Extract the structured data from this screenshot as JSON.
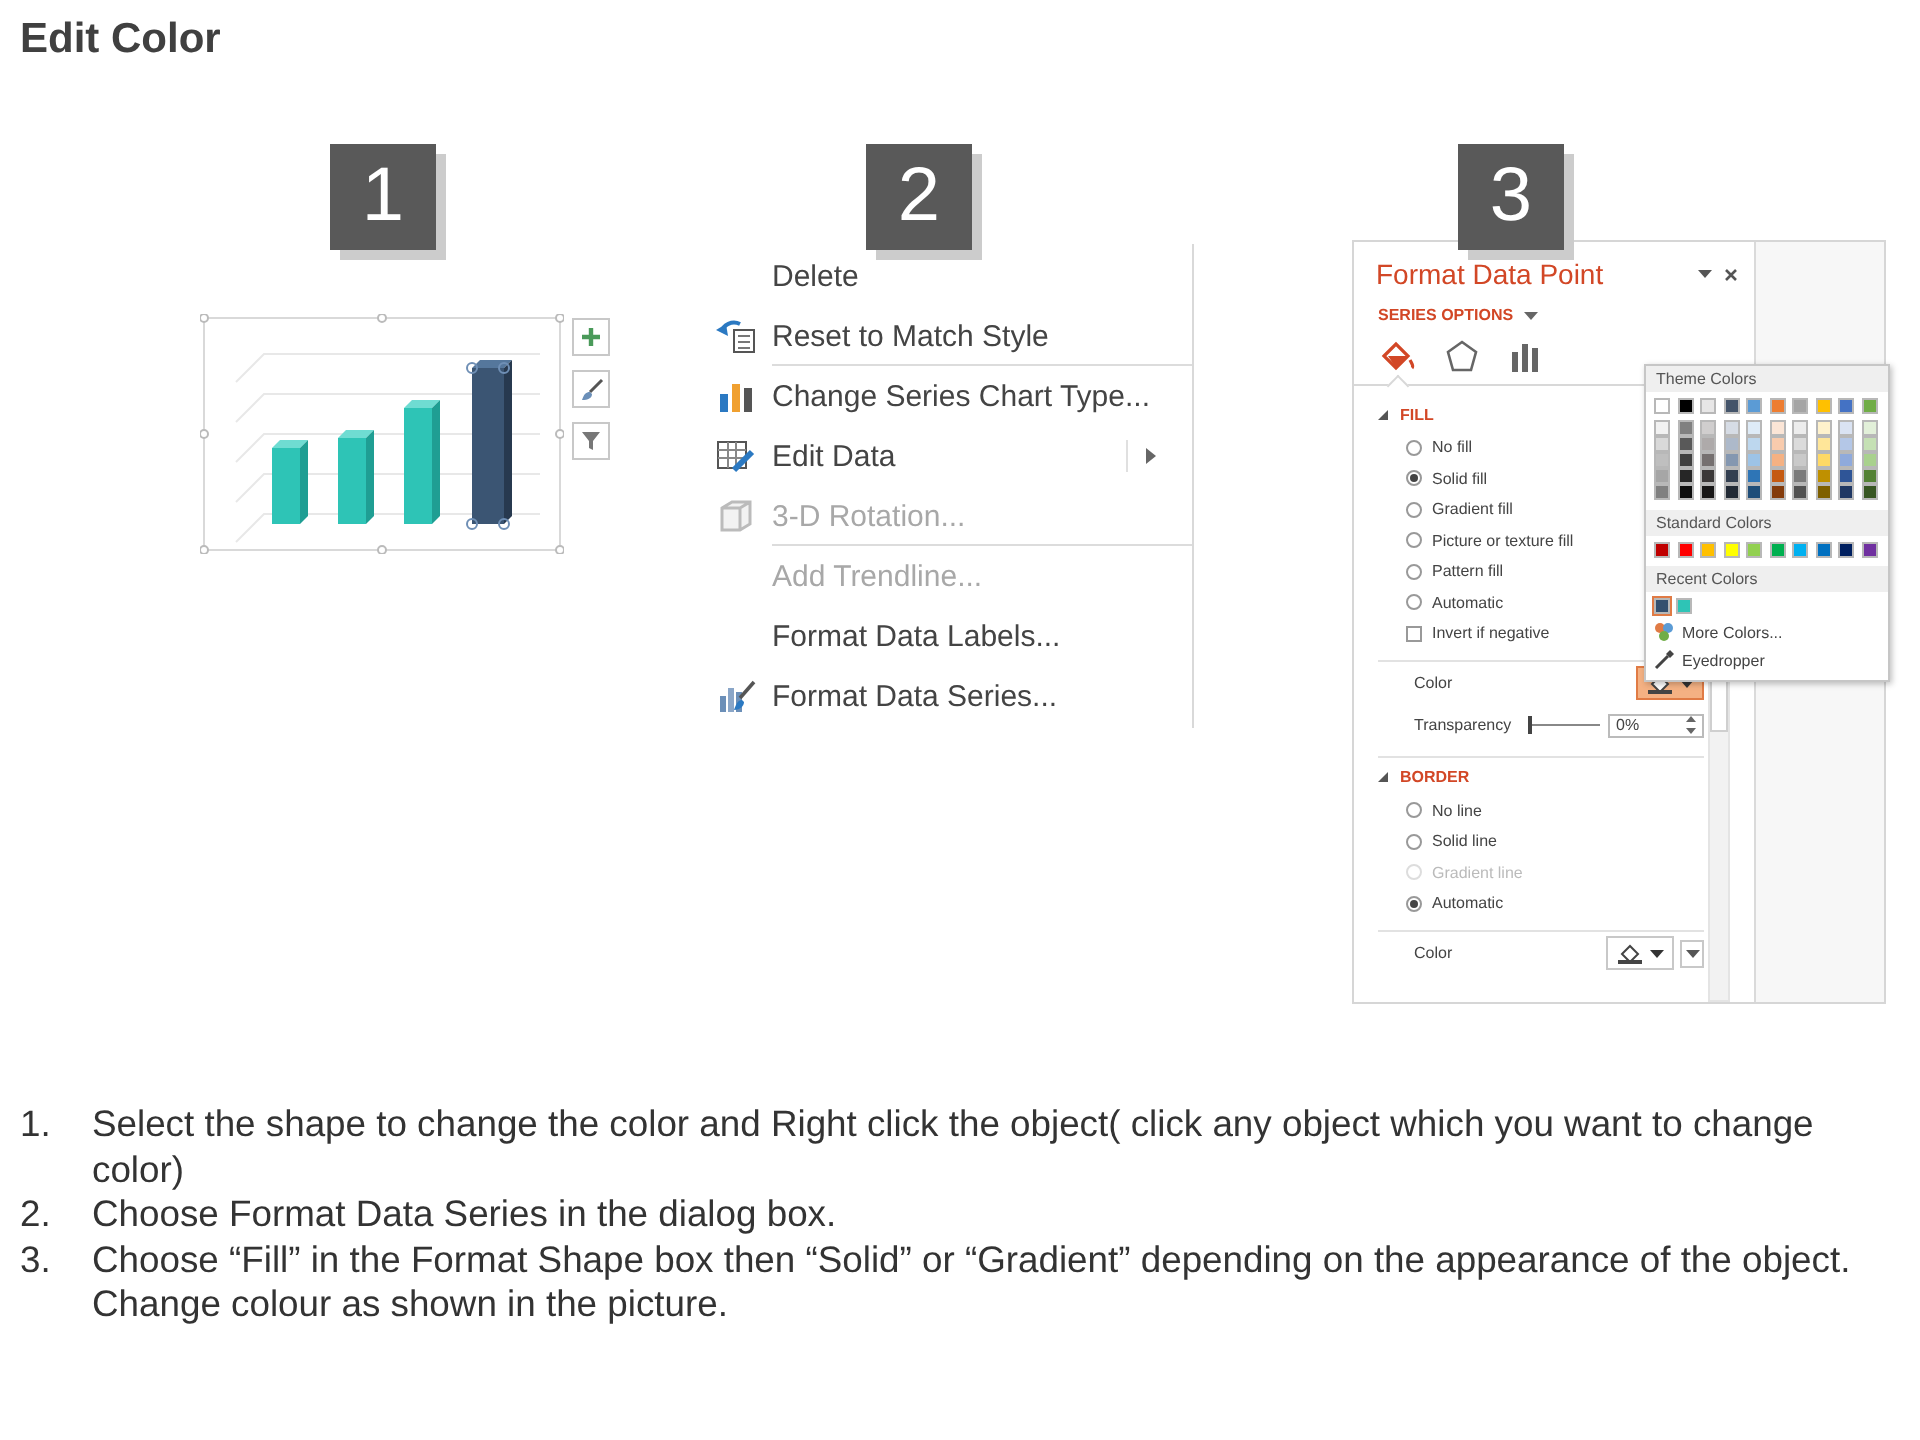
{
  "title": "Edit Color",
  "panels": [
    {
      "kind": "chart",
      "badge": "1",
      "bars": [
        {
          "selected": false
        },
        {
          "selected": false
        },
        {
          "selected": false
        },
        {
          "selected": true
        }
      ]
    },
    {
      "kind": "menu",
      "badge": "2",
      "items": [
        {
          "label": "Delete",
          "disabled": false,
          "separator_after": false,
          "submenu": false
        },
        {
          "label": "Reset to Match Style",
          "disabled": false,
          "separator_after": true,
          "submenu": false
        },
        {
          "label": "Change Series Chart Type...",
          "disabled": false,
          "separator_after": false,
          "submenu": false
        },
        {
          "label": "Edit Data",
          "disabled": false,
          "separator_after": false,
          "submenu": true
        },
        {
          "label": "3-D Rotation...",
          "disabled": true,
          "separator_after": true,
          "submenu": false
        },
        {
          "label": "Add Trendline...",
          "disabled": true,
          "separator_after": false,
          "submenu": false
        },
        {
          "label": "Format Data Labels...",
          "disabled": false,
          "separator_after": false,
          "submenu": false
        },
        {
          "label": "Format Data Series...",
          "disabled": false,
          "separator_after": false,
          "submenu": false
        }
      ]
    },
    {
      "kind": "pane",
      "badge": "3",
      "title": "Format Data Point",
      "section_menu": "SERIES OPTIONS",
      "tabs": [
        {
          "selected": true
        },
        {
          "selected": false
        },
        {
          "selected": false
        }
      ],
      "sections": [
        {
          "heading": "FILL",
          "expanded": true,
          "options": [
            {
              "label": "No fill",
              "selected": false,
              "disabled": false
            },
            {
              "label": "Solid fill",
              "selected": true,
              "disabled": false
            },
            {
              "label": "Gradient fill",
              "selected": false,
              "disabled": false
            },
            {
              "label": "Picture or texture fill",
              "selected": false,
              "disabled": false
            },
            {
              "label": "Pattern fill",
              "selected": false,
              "disabled": false
            },
            {
              "label": "Automatic",
              "selected": false,
              "disabled": false
            }
          ],
          "checkbox": {
            "label": "Invert if negative",
            "checked": false
          },
          "color": {
            "label": "Color",
            "active": true
          },
          "transparency": {
            "label": "Transparency",
            "level": 0,
            "value": "0%"
          }
        },
        {
          "heading": "BORDER",
          "expanded": true,
          "options": [
            {
              "label": "No line",
              "selected": false,
              "disabled": false
            },
            {
              "label": "Solid line",
              "selected": false,
              "disabled": false
            },
            {
              "label": "Gradient line",
              "selected": false,
              "disabled": true
            },
            {
              "label": "Automatic",
              "selected": true,
              "disabled": false
            }
          ],
          "color": {
            "label": "Color",
            "active": false
          }
        }
      ],
      "color_menu": {
        "theme_heading": "Theme Colors",
        "theme_colors": [
          {
            "color": "#ffffff",
            "shades": [
              {
                "color": "#f2f2f2"
              },
              {
                "color": "#d9d9d9"
              },
              {
                "color": "#bfbfbf"
              },
              {
                "color": "#a6a6a6"
              },
              {
                "color": "#808080"
              }
            ]
          },
          {
            "color": "#000000",
            "shades": [
              {
                "color": "#808080"
              },
              {
                "color": "#595959"
              },
              {
                "color": "#404040"
              },
              {
                "color": "#262626"
              },
              {
                "color": "#0d0d0d"
              }
            ]
          },
          {
            "color": "#e7e6e6",
            "shades": [
              {
                "color": "#d0cece"
              },
              {
                "color": "#aeaaaa"
              },
              {
                "color": "#767171"
              },
              {
                "color": "#3b3838"
              },
              {
                "color": "#181717"
              }
            ]
          },
          {
            "color": "#44546a",
            "shades": [
              {
                "color": "#d6dce5"
              },
              {
                "color": "#adb9ca"
              },
              {
                "color": "#8497b0"
              },
              {
                "color": "#333f50"
              },
              {
                "color": "#222a35"
              }
            ]
          },
          {
            "color": "#5b9bd5",
            "shades": [
              {
                "color": "#deebf7"
              },
              {
                "color": "#bdd7ee"
              },
              {
                "color": "#9dc3e6"
              },
              {
                "color": "#2e75b6"
              },
              {
                "color": "#1f4e79"
              }
            ]
          },
          {
            "color": "#ed7d31",
            "shades": [
              {
                "color": "#fbe5d6"
              },
              {
                "color": "#f8cbad"
              },
              {
                "color": "#f4b183"
              },
              {
                "color": "#c55a11"
              },
              {
                "color": "#843c0c"
              }
            ]
          },
          {
            "color": "#a5a5a5",
            "shades": [
              {
                "color": "#ededed"
              },
              {
                "color": "#dbdbdb"
              },
              {
                "color": "#c9c9c9"
              },
              {
                "color": "#7b7b7b"
              },
              {
                "color": "#525252"
              }
            ]
          },
          {
            "color": "#ffc000",
            "shades": [
              {
                "color": "#fff2cc"
              },
              {
                "color": "#ffe699"
              },
              {
                "color": "#ffd966"
              },
              {
                "color": "#bf9000"
              },
              {
                "color": "#7f6000"
              }
            ]
          },
          {
            "color": "#4472c4",
            "shades": [
              {
                "color": "#dae3f3"
              },
              {
                "color": "#b4c7e7"
              },
              {
                "color": "#8faadc"
              },
              {
                "color": "#2f5597"
              },
              {
                "color": "#203864"
              }
            ]
          },
          {
            "color": "#70ad47",
            "shades": [
              {
                "color": "#e2f0d9"
              },
              {
                "color": "#c5e0b4"
              },
              {
                "color": "#a9d18e"
              },
              {
                "color": "#548235"
              },
              {
                "color": "#385723"
              }
            ]
          }
        ],
        "standard_heading": "Standard Colors",
        "standard_colors": [
          {
            "color": "#c00000"
          },
          {
            "color": "#ff0000"
          },
          {
            "color": "#ffc000"
          },
          {
            "color": "#ffff00"
          },
          {
            "color": "#92d050"
          },
          {
            "color": "#00b050"
          },
          {
            "color": "#00b0f0"
          },
          {
            "color": "#0070c0"
          },
          {
            "color": "#002060"
          },
          {
            "color": "#7030a0"
          }
        ],
        "recent_heading": "Recent Colors",
        "recent_colors": [
          {
            "color": "#34506f",
            "selected": true
          },
          {
            "color": "#2ec4b6",
            "selected": false
          }
        ],
        "actions": [
          {
            "label": "More Colors..."
          },
          {
            "label": "Eyedropper"
          }
        ]
      }
    }
  ],
  "steps": [
    {
      "number": "1.",
      "text": "Select the shape to change the color and Right click the object( click any object which you want to change color)"
    },
    {
      "number": "2.",
      "text": "Choose Format Data Series in the dialog box."
    },
    {
      "number": "3.",
      "text": "Choose “Fill” in the Format Shape box then “Solid” or “Gradient” depending on the appearance of the object. Change colour as shown in the picture."
    }
  ]
}
